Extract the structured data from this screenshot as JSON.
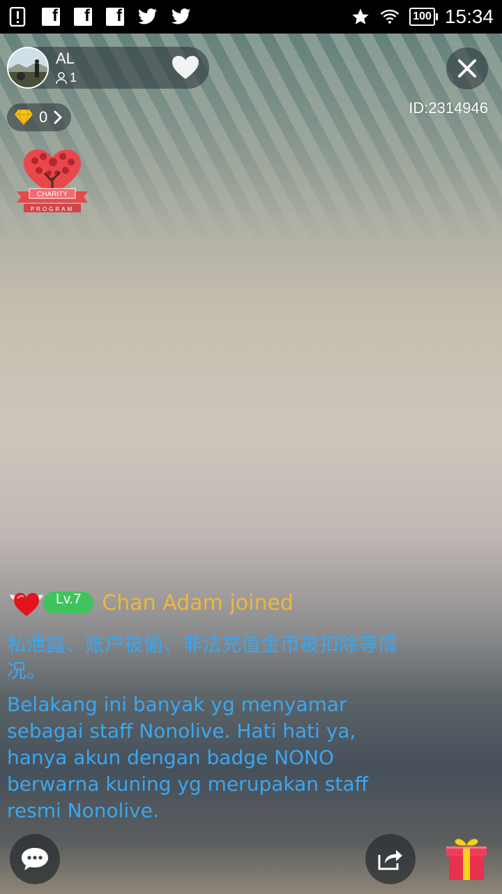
{
  "status_bar": {
    "time": "15:34",
    "battery": "100",
    "notification_icons": [
      "alert-icon",
      "facebook-icon",
      "facebook-icon",
      "facebook-icon",
      "twitter-icon",
      "twitter-icon"
    ],
    "system_icons": [
      "star-icon",
      "wifi-icon",
      "battery-icon"
    ]
  },
  "host": {
    "name": "AL",
    "viewer_count": "1"
  },
  "room": {
    "id_label": "ID:2314946"
  },
  "diamonds": {
    "count": "0"
  },
  "badges": {
    "charity_top": "CHARITY",
    "charity_bottom": "PROGRAM"
  },
  "join_event": {
    "level": "Lv.7",
    "user": "Chan Adam",
    "verb": "joined"
  },
  "chat": {
    "notice_cn": "私泄露、账户被偷、非法充值金币被扣除等情况。",
    "notice_id": "Belakang ini banyak yg menyamar sebagai staff Nonolive. Hati hati ya, hanya akun dengan badge NONO berwarna kuning yg merupakan staff resmi Nonolive."
  },
  "colors": {
    "chat_text": "#3aa7f0",
    "join_text": "#f0b63a",
    "level_badge": "#3ec45b",
    "pill_bg": "rgba(40,50,55,0.55)"
  },
  "bottom_bar": {
    "icons": [
      "chat-icon",
      "share-icon",
      "gift-icon"
    ]
  }
}
